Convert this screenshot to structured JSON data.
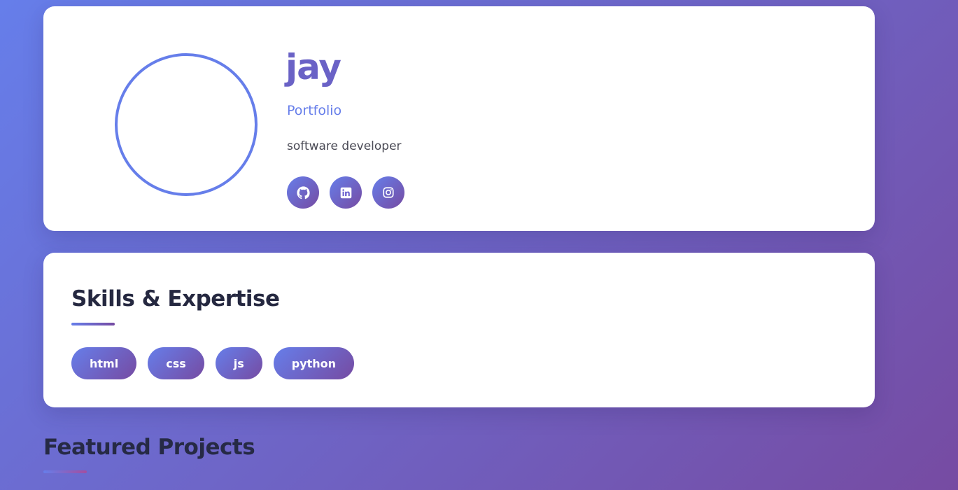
{
  "profile": {
    "name": "jay",
    "title": "Portfolio",
    "bio": "software developer",
    "social_links": [
      {
        "icon": "github-icon"
      },
      {
        "icon": "linkedin-icon"
      },
      {
        "icon": "instagram-icon"
      }
    ]
  },
  "skills": {
    "heading": "Skills & Expertise",
    "items": [
      "html",
      "css",
      "js",
      "python"
    ]
  },
  "projects": {
    "heading": "Featured Projects"
  },
  "colors": {
    "accent_start": "#667eea",
    "accent_end": "#764ba2",
    "card_background": "#ffffff",
    "heading_text": "#252840"
  }
}
